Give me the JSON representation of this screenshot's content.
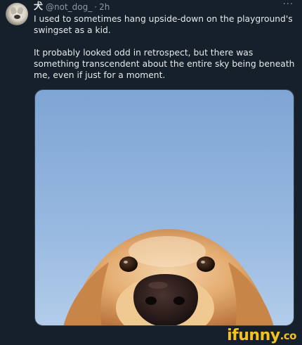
{
  "tweet": {
    "display_name": "犬",
    "handle": "@not_dog_",
    "separator": "·",
    "time": "2h",
    "more": "···",
    "paragraphs": [
      "I used to sometimes hang upside-down on the playground's swingset as a kid.",
      "It probably looked odd in retrospect, but there was something transcendent about the entire sky being beneath me, even if just for a moment."
    ],
    "avatar_icon": "dog-avatar",
    "media_subject": "dog-face-photo"
  },
  "watermark": {
    "text": "ifunny",
    "suffix": ".co",
    "color": "#f4c21a"
  },
  "colors": {
    "background": "#15202b",
    "text": "#e7e9ea",
    "secondary_text": "#8b98a5",
    "sky_top": "#7fa7d6",
    "sky_bottom": "#a9c6e8",
    "fur": "#e0a86a"
  }
}
